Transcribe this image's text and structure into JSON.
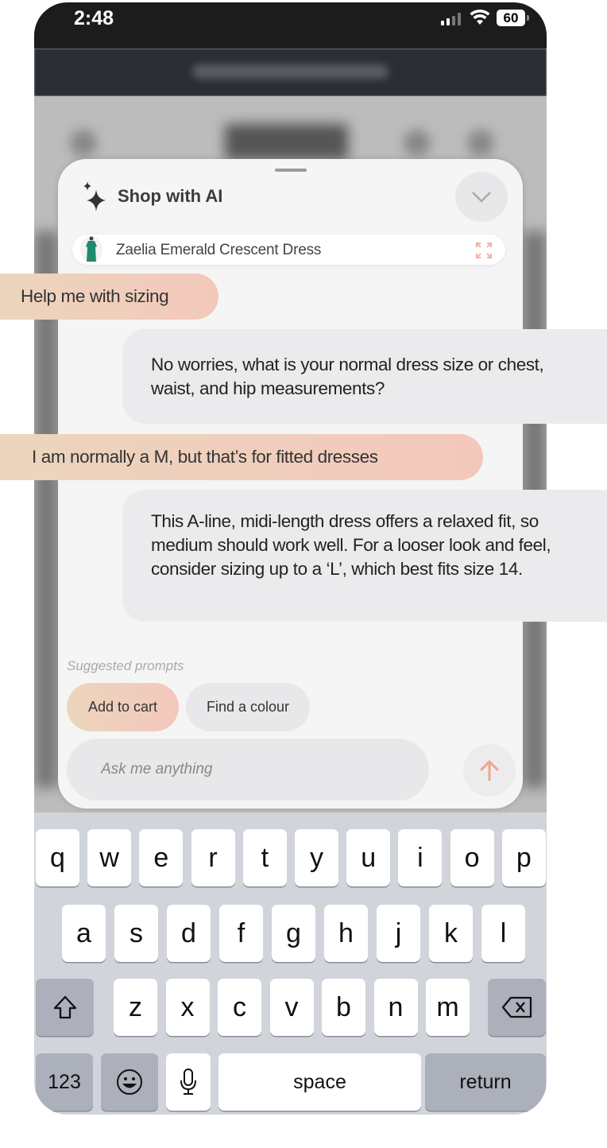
{
  "status_bar": {
    "time": "2:48",
    "battery": "60"
  },
  "panel": {
    "title": "Shop with AI",
    "product_name": "Zaelia Emerald Crescent Dress"
  },
  "messages": [
    {
      "role": "user",
      "text": "Help me with sizing"
    },
    {
      "role": "assistant",
      "text": "No worries, what is your normal dress size or chest, waist, and hip measurements?"
    },
    {
      "role": "user",
      "text": "I am normally a M, but that’s for fitted dresses"
    },
    {
      "role": "assistant",
      "text": "This A-line, midi-length dress offers a relaxed fit, so medium should work well. For a looser look and feel, consider sizing up to a ‘L’, which best fits size 14."
    }
  ],
  "suggested": {
    "label": "Suggested prompts",
    "prompts": [
      "Add to cart",
      "Find a colour"
    ]
  },
  "input": {
    "placeholder": "Ask me anything",
    "value": ""
  },
  "colors": {
    "accent_start": "#ecd5bd",
    "accent_end": "#f3c8bb",
    "send_arrow": "#f0a48e",
    "emerald": "#1f8a6e"
  },
  "keyboard": {
    "row1": [
      "q",
      "w",
      "e",
      "r",
      "t",
      "y",
      "u",
      "i",
      "o",
      "p"
    ],
    "row2": [
      "a",
      "s",
      "d",
      "f",
      "g",
      "h",
      "j",
      "k",
      "l"
    ],
    "row3": [
      "z",
      "x",
      "c",
      "v",
      "b",
      "n",
      "m"
    ],
    "numbers_label": "123",
    "space_label": "space",
    "return_label": "return"
  }
}
